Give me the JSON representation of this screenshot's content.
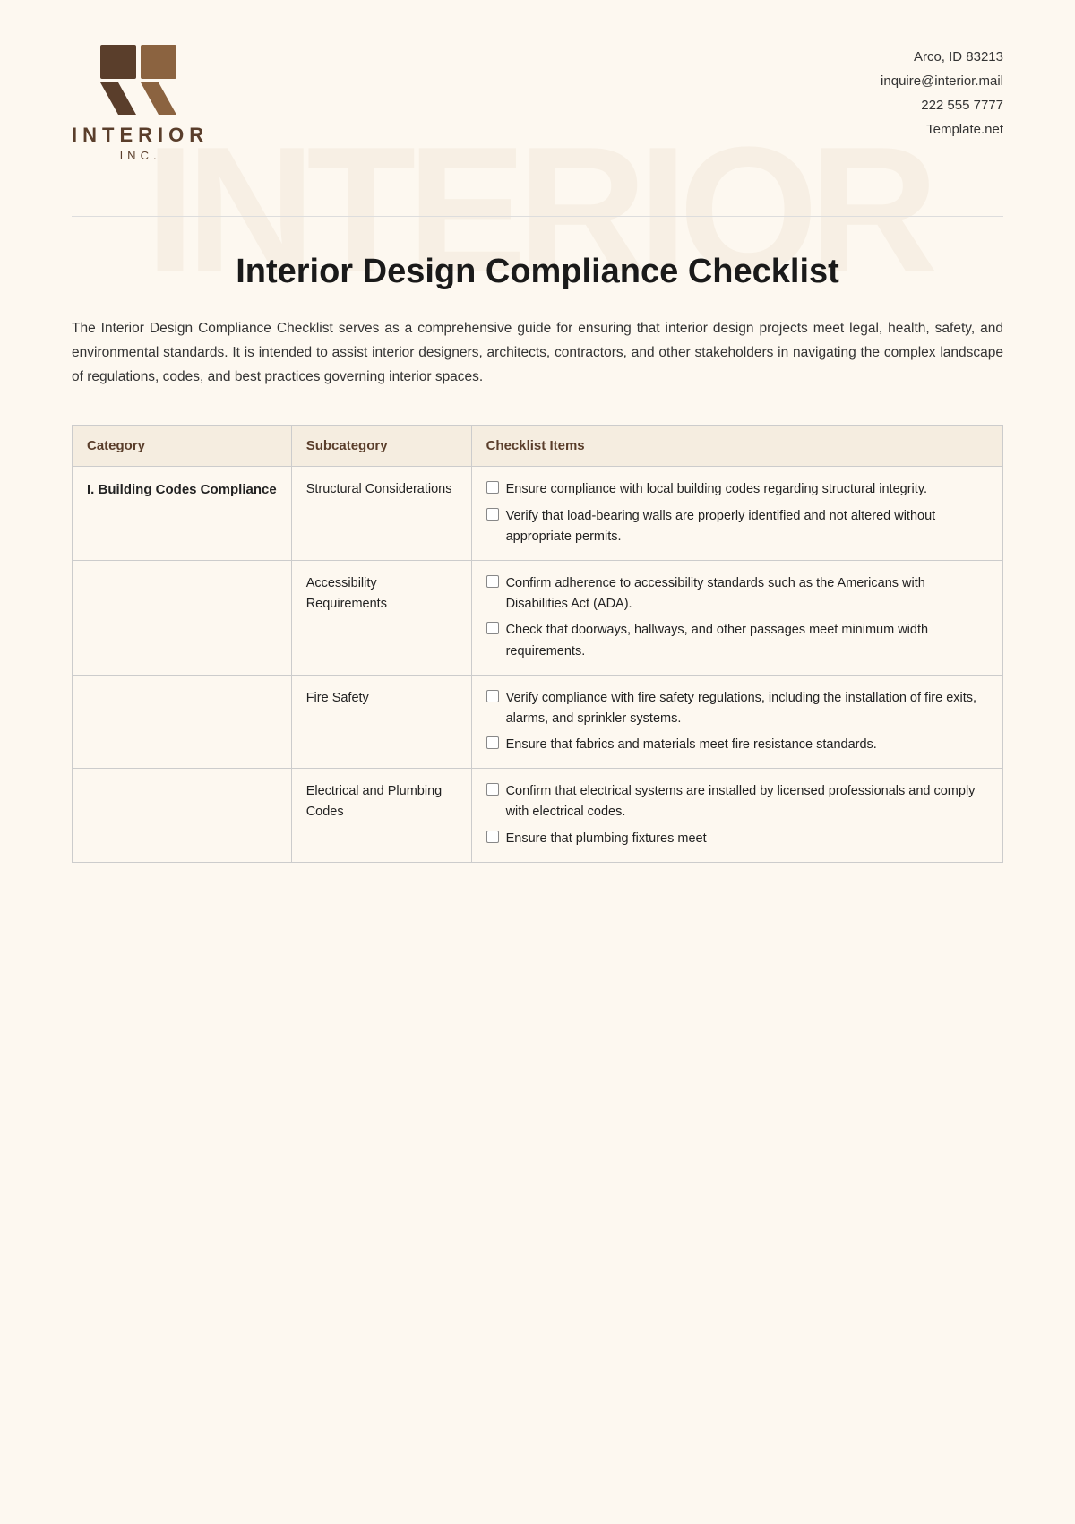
{
  "company": {
    "name": "INTERIOR",
    "sub": "INC.",
    "address": "Arco, ID 83213",
    "email": "inquire@interior.mail",
    "phone": "222 555 7777",
    "website": "Template.net"
  },
  "document": {
    "title": "Interior Design Compliance Checklist",
    "intro": "The Interior Design Compliance Checklist serves as a comprehensive guide for ensuring that interior design projects meet legal, health, safety, and environmental standards. It is intended to assist interior designers, architects, contractors, and other stakeholders in navigating the complex landscape of regulations, codes, and best practices governing interior spaces."
  },
  "table": {
    "headers": [
      "Category",
      "Subcategory",
      "Checklist Items"
    ],
    "rows": [
      {
        "category": "I. Building Codes Compliance",
        "subcategory": "Structural Considerations",
        "items": [
          "Ensure compliance with local building codes regarding structural integrity.",
          "Verify that load-bearing walls are properly identified and not altered without appropriate permits."
        ]
      },
      {
        "category": "",
        "subcategory": "Accessibility Requirements",
        "items": [
          "Confirm adherence to accessibility standards such as the Americans with Disabilities Act (ADA).",
          "Check that doorways, hallways, and other passages meet minimum width requirements."
        ]
      },
      {
        "category": "",
        "subcategory": "Fire Safety",
        "items": [
          "Verify compliance with fire safety regulations, including the installation of fire exits, alarms, and sprinkler systems.",
          "Ensure that fabrics and materials meet fire resistance standards."
        ]
      },
      {
        "category": "",
        "subcategory": "Electrical and Plumbing Codes",
        "items": [
          "Confirm that electrical systems are installed by licensed professionals and comply with electrical codes.",
          "Ensure that plumbing fixtures meet"
        ]
      }
    ]
  },
  "watermark": "INTERIOR"
}
